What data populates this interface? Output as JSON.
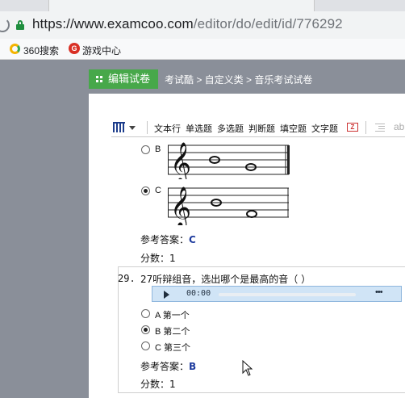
{
  "browser": {
    "url_main": "https://www.examcoo.com",
    "url_path": "/editor/do/edit/id/776292",
    "bookmarks": [
      {
        "label": "360搜索",
        "icon": "360-logo-icon"
      },
      {
        "label": "游戏中心",
        "icon": "game-center-icon"
      }
    ]
  },
  "header": {
    "edit_button": "编辑试卷",
    "breadcrumb": "考试酷 > 自定义类 > 音乐考试试卷"
  },
  "toolbar": {
    "items": [
      "文本行",
      "单选题",
      "多选题",
      "判断题",
      "填空题",
      "文字题"
    ],
    "badge": "Z",
    "trailing": "ab"
  },
  "question28": {
    "options": [
      {
        "letter": "B",
        "checked": false
      },
      {
        "letter": "C",
        "checked": true
      }
    ],
    "answer_label": "参考答案：",
    "answer_value": "C",
    "score_label": "分数：",
    "score_value": "1"
  },
  "question29": {
    "number": "29.",
    "text": "27听辩组音，选出哪个是最高的音（   ）",
    "audio_time": "00:00",
    "audio_more": "•••",
    "options": [
      {
        "letter": "A",
        "label": "第一个",
        "checked": false
      },
      {
        "letter": "B",
        "label": "第二个",
        "checked": true
      },
      {
        "letter": "C",
        "label": "第三个",
        "checked": false
      }
    ],
    "answer_label": "参考答案：",
    "answer_value": "B",
    "score_label": "分数：",
    "score_value": "1"
  }
}
